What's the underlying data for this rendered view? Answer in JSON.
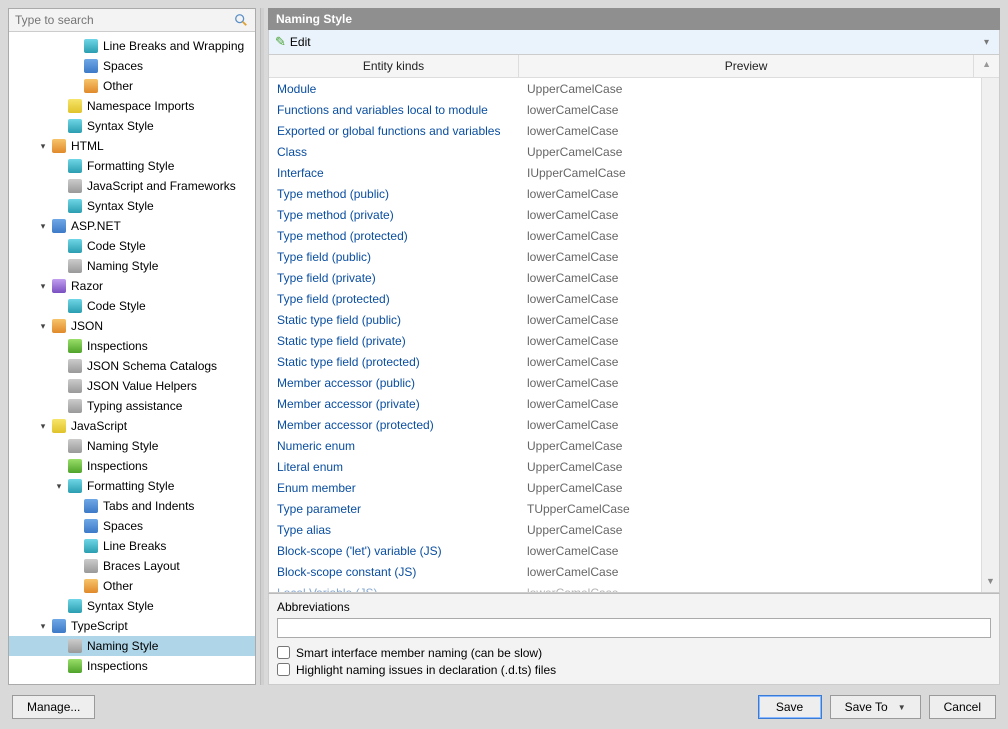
{
  "search": {
    "placeholder": "Type to search"
  },
  "panel": {
    "title": "Naming Style"
  },
  "toolbar": {
    "edit": "Edit"
  },
  "columns": {
    "entity": "Entity kinds",
    "preview": "Preview"
  },
  "tree": [
    {
      "indent": 2,
      "caret": "",
      "icon": "ic-teal",
      "label": "Line Breaks and Wrapping"
    },
    {
      "indent": 2,
      "caret": "",
      "icon": "ic-blue",
      "label": "Spaces"
    },
    {
      "indent": 2,
      "caret": "",
      "icon": "ic-orange",
      "label": "Other"
    },
    {
      "indent": 1,
      "caret": "",
      "icon": "ic-yel",
      "label": "Namespace Imports"
    },
    {
      "indent": 1,
      "caret": "",
      "icon": "ic-teal",
      "label": "Syntax Style"
    },
    {
      "indent": 0,
      "caret": "▾",
      "icon": "ic-orange",
      "label": "HTML"
    },
    {
      "indent": 1,
      "caret": "",
      "icon": "ic-teal",
      "label": "Formatting Style"
    },
    {
      "indent": 1,
      "caret": "",
      "icon": "ic-gray",
      "label": "JavaScript and Frameworks"
    },
    {
      "indent": 1,
      "caret": "",
      "icon": "ic-teal",
      "label": "Syntax Style"
    },
    {
      "indent": 0,
      "caret": "▾",
      "icon": "ic-blue",
      "label": "ASP.NET"
    },
    {
      "indent": 1,
      "caret": "",
      "icon": "ic-teal",
      "label": "Code Style"
    },
    {
      "indent": 1,
      "caret": "",
      "icon": "ic-gray",
      "label": "Naming Style"
    },
    {
      "indent": 0,
      "caret": "▾",
      "icon": "ic-purple",
      "label": "Razor"
    },
    {
      "indent": 1,
      "caret": "",
      "icon": "ic-teal",
      "label": "Code Style"
    },
    {
      "indent": 0,
      "caret": "▾",
      "icon": "ic-orange",
      "label": "JSON"
    },
    {
      "indent": 1,
      "caret": "",
      "icon": "ic-green",
      "label": "Inspections"
    },
    {
      "indent": 1,
      "caret": "",
      "icon": "ic-gray",
      "label": "JSON Schema Catalogs"
    },
    {
      "indent": 1,
      "caret": "",
      "icon": "ic-gray",
      "label": "JSON Value Helpers"
    },
    {
      "indent": 1,
      "caret": "",
      "icon": "ic-gray",
      "label": "Typing assistance"
    },
    {
      "indent": 0,
      "caret": "▾",
      "icon": "ic-yel",
      "label": "JavaScript"
    },
    {
      "indent": 1,
      "caret": "",
      "icon": "ic-gray",
      "label": "Naming Style"
    },
    {
      "indent": 1,
      "caret": "",
      "icon": "ic-green",
      "label": "Inspections"
    },
    {
      "indent": 1,
      "caret": "▾",
      "icon": "ic-teal",
      "label": "Formatting Style"
    },
    {
      "indent": 2,
      "caret": "",
      "icon": "ic-blue",
      "label": "Tabs and Indents"
    },
    {
      "indent": 2,
      "caret": "",
      "icon": "ic-blue",
      "label": "Spaces"
    },
    {
      "indent": 2,
      "caret": "",
      "icon": "ic-teal",
      "label": "Line Breaks"
    },
    {
      "indent": 2,
      "caret": "",
      "icon": "ic-gray",
      "label": "Braces Layout"
    },
    {
      "indent": 2,
      "caret": "",
      "icon": "ic-orange",
      "label": "Other"
    },
    {
      "indent": 1,
      "caret": "",
      "icon": "ic-teal",
      "label": "Syntax Style"
    },
    {
      "indent": 0,
      "caret": "▾",
      "icon": "ic-blue",
      "label": "TypeScript"
    },
    {
      "indent": 1,
      "caret": "",
      "icon": "ic-gray",
      "label": "Naming Style",
      "selected": true
    },
    {
      "indent": 1,
      "caret": "",
      "icon": "ic-green",
      "label": "Inspections"
    }
  ],
  "rows": [
    {
      "entity": "Module",
      "preview": "UpperCamelCase"
    },
    {
      "entity": "Functions and variables local to module",
      "preview": "lowerCamelCase"
    },
    {
      "entity": "Exported or global functions and variables",
      "preview": "lowerCamelCase"
    },
    {
      "entity": "Class",
      "preview": "UpperCamelCase"
    },
    {
      "entity": "Interface",
      "preview": "IUpperCamelCase"
    },
    {
      "entity": "Type method (public)",
      "preview": "lowerCamelCase"
    },
    {
      "entity": "Type method (private)",
      "preview": "lowerCamelCase"
    },
    {
      "entity": "Type method (protected)",
      "preview": "lowerCamelCase"
    },
    {
      "entity": "Type field (public)",
      "preview": "lowerCamelCase"
    },
    {
      "entity": "Type field (private)",
      "preview": "lowerCamelCase"
    },
    {
      "entity": "Type field (protected)",
      "preview": "lowerCamelCase"
    },
    {
      "entity": "Static type field (public)",
      "preview": "lowerCamelCase"
    },
    {
      "entity": "Static type field (private)",
      "preview": "lowerCamelCase"
    },
    {
      "entity": "Static type field (protected)",
      "preview": "lowerCamelCase"
    },
    {
      "entity": "Member accessor (public)",
      "preview": "lowerCamelCase"
    },
    {
      "entity": "Member accessor (private)",
      "preview": "lowerCamelCase"
    },
    {
      "entity": "Member accessor (protected)",
      "preview": "lowerCamelCase"
    },
    {
      "entity": "Numeric enum",
      "preview": "UpperCamelCase"
    },
    {
      "entity": "Literal enum",
      "preview": "UpperCamelCase"
    },
    {
      "entity": "Enum member",
      "preview": "UpperCamelCase"
    },
    {
      "entity": "Type parameter",
      "preview": "TUpperCamelCase"
    },
    {
      "entity": "Type alias",
      "preview": "UpperCamelCase"
    },
    {
      "entity": "Block-scope ('let') variable (JS)",
      "preview": "lowerCamelCase"
    },
    {
      "entity": "Block-scope constant (JS)",
      "preview": "lowerCamelCase"
    },
    {
      "entity": "Local Variable (JS)",
      "preview": "lowerCamelCase",
      "faded": true
    }
  ],
  "bottom": {
    "abbreviations_label": "Abbreviations",
    "check1": "Smart interface member naming (can be slow)",
    "check2": "Highlight naming issues in declaration (.d.ts) files"
  },
  "footer": {
    "manage": "Manage...",
    "save": "Save",
    "save_to": "Save To",
    "cancel": "Cancel"
  }
}
